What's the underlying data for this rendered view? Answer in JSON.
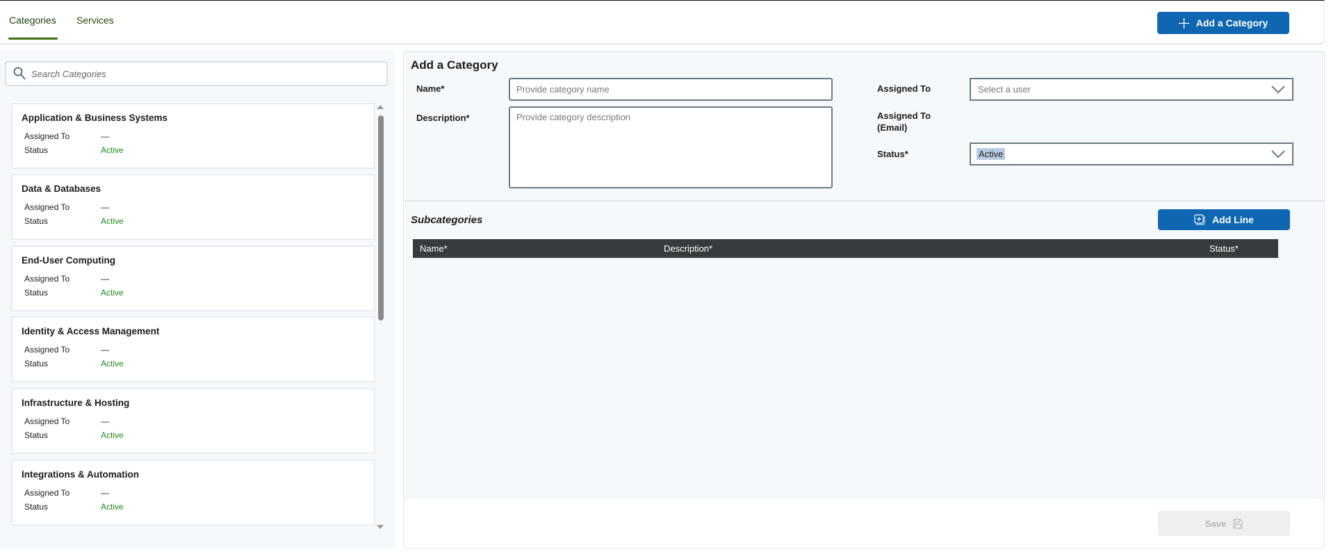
{
  "tabs": [
    {
      "label": "Categories",
      "active": true
    },
    {
      "label": "Services",
      "active": false
    }
  ],
  "header": {
    "add_category_label": "Add a Category"
  },
  "search": {
    "placeholder": "Search Categories"
  },
  "categories": [
    {
      "name": "Application & Business Systems",
      "assigned_label": "Assigned To",
      "assigned": "—",
      "status_label": "Status",
      "status": "Active"
    },
    {
      "name": "Data & Databases",
      "assigned_label": "Assigned To",
      "assigned": "—",
      "status_label": "Status",
      "status": "Active"
    },
    {
      "name": "End-User Computing",
      "assigned_label": "Assigned To",
      "assigned": "—",
      "status_label": "Status",
      "status": "Active"
    },
    {
      "name": "Identity & Access Management",
      "assigned_label": "Assigned To",
      "assigned": "—",
      "status_label": "Status",
      "status": "Active"
    },
    {
      "name": "Infrastructure & Hosting",
      "assigned_label": "Assigned To",
      "assigned": "—",
      "status_label": "Status",
      "status": "Active"
    },
    {
      "name": "Integrations & Automation",
      "assigned_label": "Assigned To",
      "assigned": "—",
      "status_label": "Status",
      "status": "Active"
    }
  ],
  "form": {
    "title": "Add a Category",
    "name_label": "Name*",
    "name_placeholder": "Provide category name",
    "description_label": "Description*",
    "description_placeholder": "Provide category description",
    "assigned_label": "Assigned To",
    "assigned_placeholder": "Select a user",
    "assigned_email_label_1": "Assigned To",
    "assigned_email_label_2": "(Email)",
    "status_label": "Status*",
    "status_value": "Active"
  },
  "subcategories": {
    "title": "Subcategories",
    "add_line_label": "Add Line",
    "columns": [
      "Name*",
      "Description*",
      "Status*"
    ]
  },
  "footer": {
    "save_label": "Save"
  },
  "colors": {
    "primary": "#0f67b1",
    "active_status": "#178a17",
    "tab_accent": "#3f6e12",
    "table_header": "#363b3d"
  }
}
